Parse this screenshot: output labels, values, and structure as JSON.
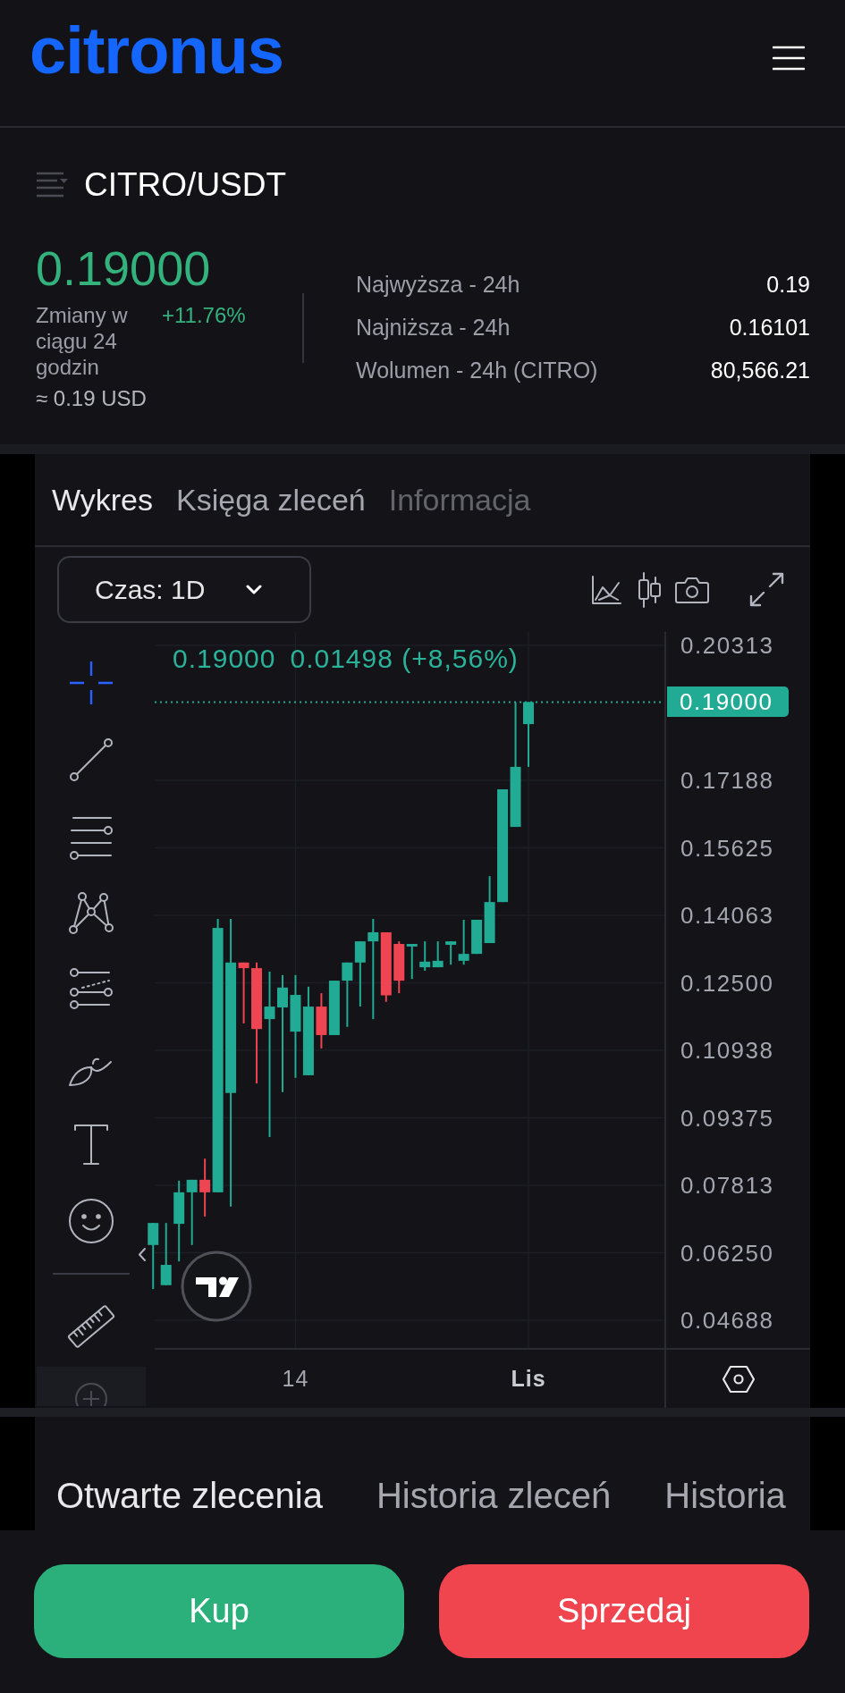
{
  "header": {
    "logo": "citronus"
  },
  "ticker": {
    "pair": "CITRO/USDT",
    "last_price": "0.19000",
    "change_label": "Zmiany w ciągu 24 godzin",
    "change": "+11.76%",
    "usd_equivalent": "≈ 0.19 USD",
    "stats": [
      {
        "label": "Najwyższa - 24h",
        "value": "0.19"
      },
      {
        "label": "Najniższa - 24h",
        "value": "0.16101"
      },
      {
        "label": "Wolumen - 24h (CITRO)",
        "value": "80,566.21"
      }
    ]
  },
  "chart_panel": {
    "tabs": [
      {
        "label": "Wykres",
        "selected": true,
        "disabled": false
      },
      {
        "label": "Księga zleceń",
        "selected": false,
        "disabled": false
      },
      {
        "label": "Informacja",
        "selected": false,
        "disabled": true
      }
    ],
    "interval": {
      "label": "Czas: 1D"
    },
    "tool_groups": [
      {
        "tools": [
          {
            "kind": "crosshair",
            "selected": true
          },
          {
            "kind": "trend_line",
            "selected": false
          },
          {
            "kind": "horizontal_lines",
            "selected": false
          },
          {
            "kind": "pattern",
            "selected": false
          },
          {
            "kind": "fib_channel",
            "selected": false
          },
          {
            "kind": "brush",
            "selected": false
          },
          {
            "kind": "text",
            "selected": false
          },
          {
            "kind": "emoji",
            "selected": false
          }
        ]
      },
      {
        "tools": [
          {
            "kind": "ruler",
            "selected": false
          }
        ]
      }
    ],
    "legend": {
      "price": "0.19000",
      "change": "0.01498 (+8,56%)"
    },
    "time_label_styles": [
      {
        "bold": false
      },
      {
        "bold": true
      }
    ],
    "chart_data": {
      "type": "candlestick",
      "grid": true,
      "categories": [
        null,
        null,
        null,
        null,
        null,
        null,
        null,
        null,
        null,
        null,
        null,
        "14",
        null,
        null,
        null,
        null,
        null,
        null,
        null,
        null,
        null,
        null,
        null,
        null,
        null,
        null,
        null,
        null,
        null,
        "Lis",
        null,
        null,
        null,
        null,
        null,
        null,
        null,
        null,
        null,
        null
      ],
      "ohlc": [
        [
          0.0643,
          0.0694,
          0.0541,
          0.0694
        ],
        [
          0.055,
          0.0694,
          0.055,
          0.0597
        ],
        [
          0.0692,
          0.0792,
          0.0605,
          0.0765
        ],
        [
          0.0765,
          0.0794,
          0.0643,
          0.0794
        ],
        [
          0.0794,
          0.0843,
          0.0709,
          0.0765
        ],
        [
          0.0765,
          0.1398,
          0.0765,
          0.1377
        ],
        [
          0.0995,
          0.1398,
          0.0732,
          0.1297
        ],
        [
          0.1297,
          0.1297,
          0.1156,
          0.1284
        ],
        [
          0.1284,
          0.1297,
          0.1017,
          0.1143
        ],
        [
          0.1166,
          0.1276,
          0.0893,
          0.1195
        ],
        [
          0.1193,
          0.1268,
          0.0997,
          0.1239
        ],
        [
          0.1137,
          0.1268,
          0.103,
          0.1222
        ],
        [
          0.1036,
          0.1241,
          0.1036,
          0.1195
        ],
        [
          0.1195,
          0.1226,
          0.1098,
          0.1129
        ],
        [
          0.1129,
          0.1255,
          0.1129,
          0.1255
        ],
        [
          0.1255,
          0.1297,
          0.1148,
          0.1297
        ],
        [
          0.1297,
          0.1346,
          0.1195,
          0.1346
        ],
        [
          0.1346,
          0.1398,
          0.1166,
          0.1367
        ],
        [
          0.1367,
          0.1367,
          0.1206,
          0.1221
        ],
        [
          0.134,
          0.1346,
          0.1226,
          0.1255
        ],
        [
          0.1334,
          0.134,
          0.1259,
          0.134
        ],
        [
          0.1286,
          0.1346,
          0.1278,
          0.1299
        ],
        [
          0.1286,
          0.1346,
          0.1286,
          0.1301
        ],
        [
          0.1338,
          0.1346,
          0.1292,
          0.1346
        ],
        [
          0.1301,
          0.1396,
          0.1292,
          0.1317
        ],
        [
          0.1317,
          0.1396,
          0.1317,
          0.1396
        ],
        [
          0.1342,
          0.1497,
          0.1342,
          0.1437
        ],
        [
          0.1437,
          0.1698,
          0.1437,
          0.1698
        ],
        [
          0.1611,
          0.1899,
          0.1611,
          0.175
        ],
        [
          0.1849,
          0.19,
          0.175,
          0.19
        ],
        null,
        null,
        null,
        null,
        null,
        null,
        null,
        null,
        null,
        null
      ],
      "ylim": [
        0.04046,
        0.20623
      ],
      "yticks": [
        {
          "value": 0.203125,
          "label": "0.20313"
        },
        {
          "value": 0.171875,
          "label": "0.17188"
        },
        {
          "value": 0.15625,
          "label": "0.15625"
        },
        {
          "value": 0.140625,
          "label": "0.14063"
        },
        {
          "value": 0.125,
          "label": "0.12500"
        },
        {
          "value": 0.109375,
          "label": "0.10938"
        },
        {
          "value": 0.09375,
          "label": "0.09375"
        },
        {
          "value": 0.078125,
          "label": "0.07813"
        },
        {
          "value": 0.0625,
          "label": "0.06250"
        },
        {
          "value": 0.046875,
          "label": "0.04688"
        }
      ],
      "ref_lines": [
        {
          "axis": "y",
          "value": 0.19,
          "label": "0.19000"
        }
      ]
    }
  },
  "order_tabs": [
    {
      "label": "Otwarte zlecenia",
      "selected": true
    },
    {
      "label": "Historia zleceń",
      "selected": false
    },
    {
      "label": "Historia",
      "selected": false
    }
  ],
  "actions": [
    {
      "label": "Kup",
      "kind": "buy"
    },
    {
      "label": "Sprzedaj",
      "kind": "sell"
    }
  ]
}
